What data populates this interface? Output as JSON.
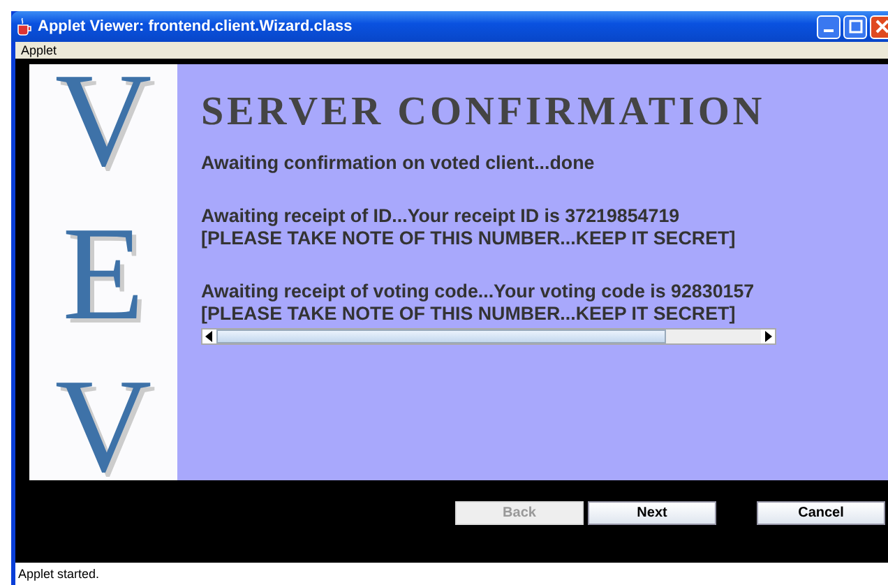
{
  "window": {
    "title": "Applet Viewer: frontend.client.Wizard.class"
  },
  "menu": [
    "Applet"
  ],
  "logo_letters": [
    "V",
    "E",
    "V"
  ],
  "heading": "SERVER CONFIRMATION",
  "messages": [
    {
      "lines": [
        "Awaiting confirmation on voted client...done"
      ]
    },
    {
      "lines": [
        "Awaiting receipt of ID...Your receipt ID is 37219854719",
        "[PLEASE TAKE NOTE OF THIS NUMBER...KEEP IT SECRET]"
      ]
    },
    {
      "lines": [
        "Awaiting receipt of voting code...Your voting code is 92830157",
        "[PLEASE TAKE NOTE OF THIS NUMBER...KEEP IT SECRET]"
      ]
    }
  ],
  "buttons": [
    {
      "label": "Back",
      "disabled": true
    },
    {
      "label": "Next",
      "disabled": false
    },
    {
      "label": "Cancel",
      "disabled": false
    }
  ],
  "status_bar": "Applet started."
}
